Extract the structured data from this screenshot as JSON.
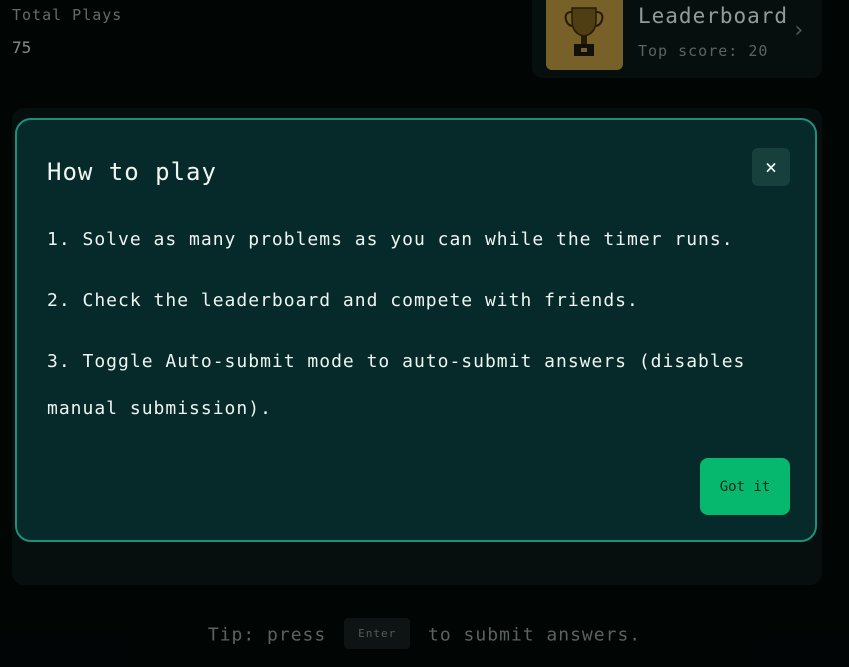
{
  "stats": {
    "label": "Total Plays",
    "value": "75"
  },
  "leaderboard": {
    "title": "Leaderboard",
    "subtitle": "Top score: 20",
    "chevron": "›",
    "icon": "trophy-icon"
  },
  "modal": {
    "title": "How to play",
    "close_label": "×",
    "steps": [
      "1. Solve as many problems as you can while the timer runs.",
      "2. Check the leaderboard and compete with friends.",
      "3. Toggle Auto-submit mode to auto-submit answers (disables manual submission)."
    ],
    "confirm_label": "Got it"
  },
  "tip": {
    "prefix": "Tip: press",
    "key": "Enter",
    "suffix": "to submit answers."
  },
  "colors": {
    "modal_bg": "#062a29",
    "modal_border": "#1f8f7a",
    "accent_button": "#06b86e",
    "trophy_bg": "#b8953f"
  }
}
